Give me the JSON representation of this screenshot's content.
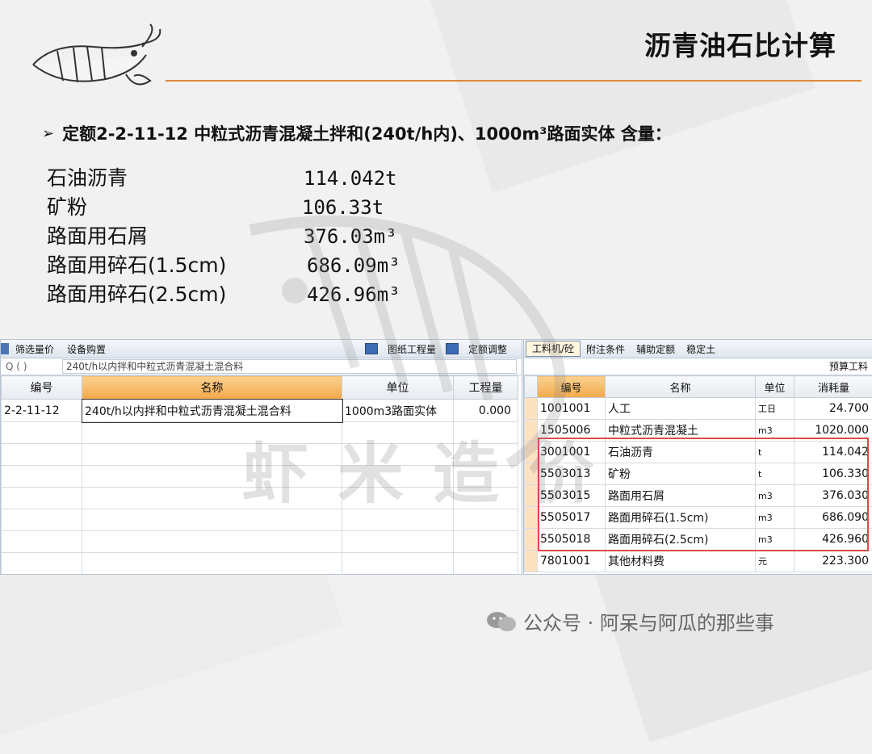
{
  "slide_title": "沥青油石比计算",
  "bullet_text": "定额2-2-11-12 中粒式沥青混凝土拌和(240t/h内)、1000m³路面实体 含量：",
  "materials": [
    {
      "name": "石油沥青",
      "qty": "114.042t"
    },
    {
      "name": "矿粉",
      "qty": "106.33t"
    },
    {
      "name": "路面用石屑",
      "qty": "376.03m³"
    },
    {
      "name": "路面用碎石(1.5cm)",
      "qty": "686.09m³"
    },
    {
      "name": "路面用碎石(2.5cm)",
      "qty": "426.96m³"
    }
  ],
  "watermark_text": "虾米造价",
  "left_panel": {
    "toolbar": [
      "筛选量价",
      "设备购置"
    ],
    "tools": [
      "图纸工程量",
      "定额调整"
    ],
    "search_q": "Q ( )",
    "search_text": "240t/h以内拌和中粒式沥青混凝土混合料",
    "headers": [
      "编号",
      "名称",
      "单位",
      "工程量"
    ],
    "row": {
      "code": "2-2-11-12",
      "name": "240t/h以内拌和中粒式沥青混凝土混合料",
      "unit": "1000m3路面实体",
      "qty": "0.000"
    }
  },
  "right_panel": {
    "tabs": [
      "工料机/砼",
      "附注条件",
      "辅助定额",
      "稳定土"
    ],
    "sub_header": "预算工料",
    "headers": [
      "编号",
      "名称",
      "单位",
      "消耗量"
    ],
    "rows": [
      {
        "code": "1001001",
        "name": "人工",
        "unit": "工日",
        "qty": "24.700"
      },
      {
        "code": "1505006",
        "name": "中粒式沥青混凝土",
        "unit": "m3",
        "qty": "1020.000"
      },
      {
        "code": "3001001",
        "name": "石油沥青",
        "unit": "t",
        "qty": "114.042"
      },
      {
        "code": "5503013",
        "name": "矿粉",
        "unit": "t",
        "qty": "106.330"
      },
      {
        "code": "5503015",
        "name": "路面用石屑",
        "unit": "m3",
        "qty": "376.030"
      },
      {
        "code": "5505017",
        "name": "路面用碎石(1.5cm)",
        "unit": "m3",
        "qty": "686.090"
      },
      {
        "code": "5505018",
        "name": "路面用碎石(2.5cm)",
        "unit": "m3",
        "qty": "426.960"
      },
      {
        "code": "7801001",
        "name": "其他材料费",
        "unit": "元",
        "qty": "223.300"
      }
    ]
  },
  "footer_text": "公众号 · 阿呆与阿瓜的那些事",
  "colors": {
    "accent_line": "#e08a3a",
    "highlight": "#e04848",
    "header_active": "#f3a84a"
  }
}
